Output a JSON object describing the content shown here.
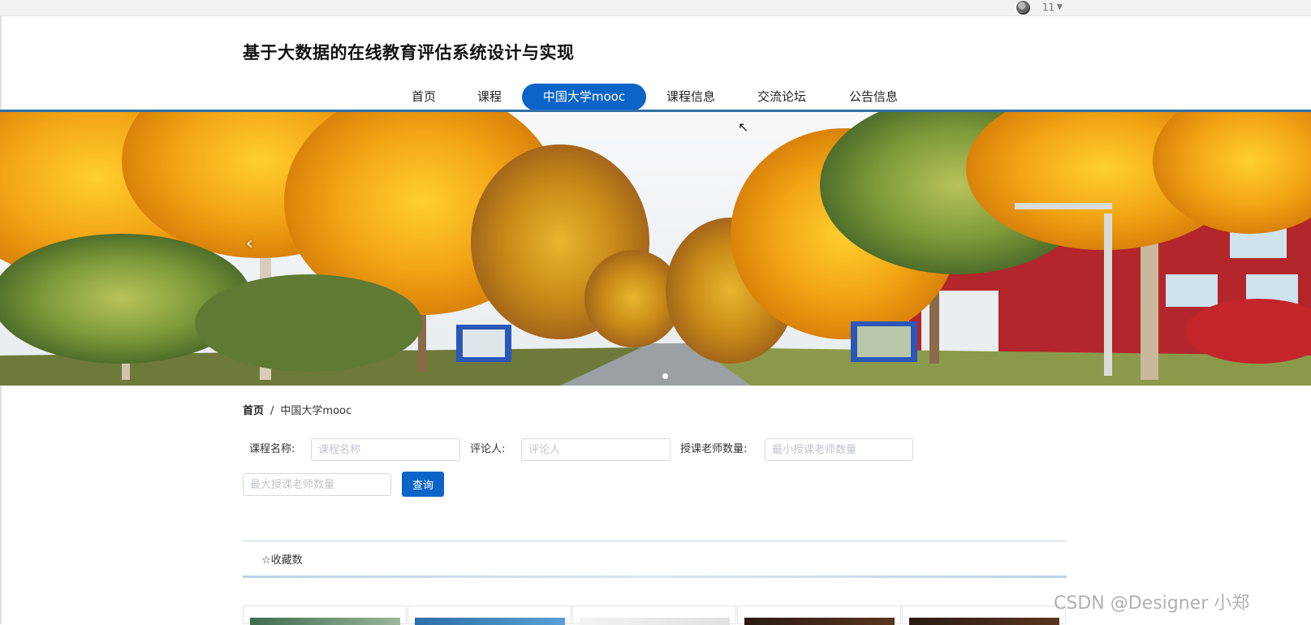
{
  "topbar": {
    "username": "11",
    "caret_icon": "caret-down-icon"
  },
  "site": {
    "title": "基于大数据的在线教育评估系统设计与实现"
  },
  "nav": {
    "items": [
      {
        "label": "首页",
        "active": false
      },
      {
        "label": "课程",
        "active": false
      },
      {
        "label": "中国大学mooc",
        "active": true
      },
      {
        "label": "课程信息",
        "active": false
      },
      {
        "label": "交流论坛",
        "active": false
      },
      {
        "label": "公告信息",
        "active": false
      }
    ],
    "accent_color": "#0b64c8"
  },
  "banner": {
    "prev_icon": "chevron-left-icon",
    "slide_count": 1,
    "active_slide": 1
  },
  "breadcrumb": {
    "home": "首页",
    "separator": "/",
    "current": "中国大学mooc"
  },
  "search": {
    "course_name_label": "课程名称:",
    "course_name_placeholder": "课程名称",
    "reviewer_label": "评论人:",
    "reviewer_placeholder": "评论人",
    "teacher_count_label": "授课老师数量:",
    "min_teacher_placeholder": "最小授课老师数量",
    "max_teacher_placeholder": "最大授课老师数量",
    "query_button": "查询"
  },
  "sort": {
    "star_icon": "☆",
    "favorites_label": "收藏数"
  },
  "cards": {
    "visible_count": 5
  },
  "watermark": "CSDN @Designer 小郑"
}
